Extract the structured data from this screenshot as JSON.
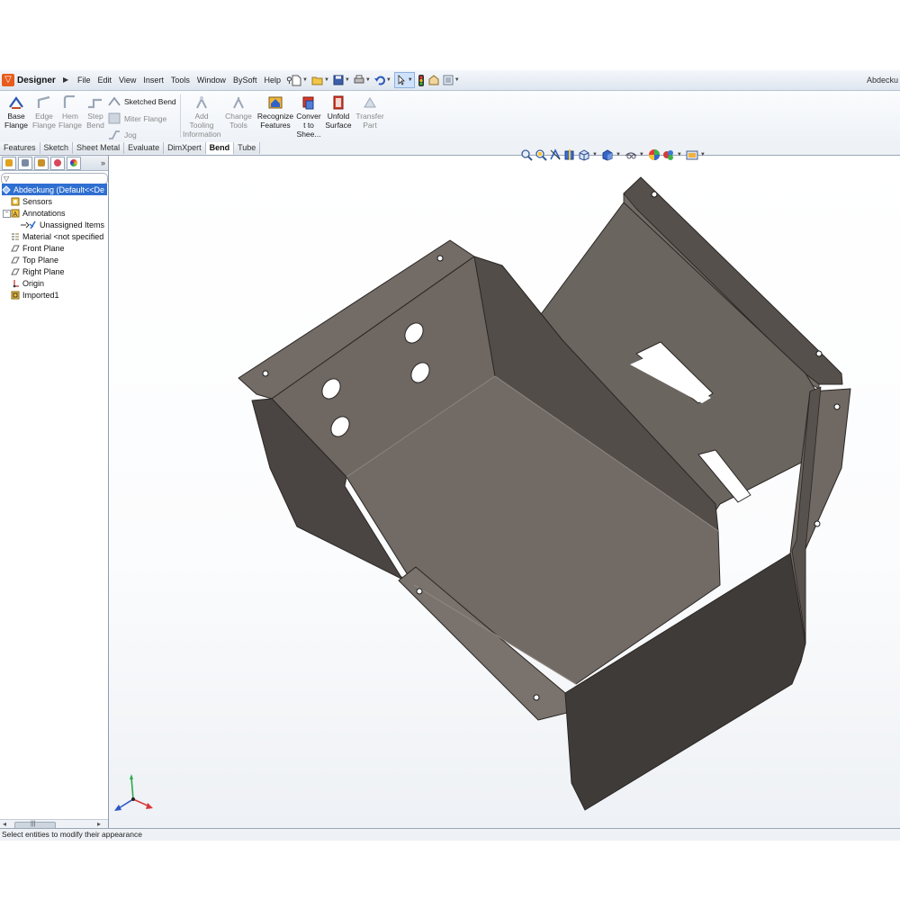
{
  "app": {
    "brand": "Designer",
    "document_title": "Abdecku",
    "accent_orange": "#e85b1c",
    "selection_blue": "#2f6fd1"
  },
  "menu": {
    "items": [
      "File",
      "Edit",
      "View",
      "Insert",
      "Tools",
      "Window",
      "BySoft",
      "Help"
    ]
  },
  "quick_access": {
    "icons": [
      "new-document-icon",
      "open-folder-icon",
      "save-icon",
      "print-icon",
      "undo-icon",
      "select-pointer-icon",
      "rebuild-icon",
      "file-properties-icon",
      "options-icon"
    ]
  },
  "ribbon": {
    "base_flange": "Base\nFlange",
    "edge_flange": "Edge\nFlange",
    "hem_flange": "Hem\nFlange",
    "step_bend": "Step\nBend",
    "sketched_bend": "Sketched Bend",
    "miter_flange": "Miter Flange",
    "jog": "Jog",
    "add_tooling": "Add\nTooling\nInformation",
    "change_tools": "Change\nTools",
    "recognize_features": "Recognize\nFeatures",
    "convert_to_sheet": "Conver\nt to\nShee...",
    "unfold_surface": "Unfold\nSurface",
    "transfer_part": "Transfer\nPart"
  },
  "tabs": [
    {
      "label": "Features",
      "active": false
    },
    {
      "label": "Sketch",
      "active": false
    },
    {
      "label": "Sheet Metal",
      "active": false
    },
    {
      "label": "Evaluate",
      "active": false
    },
    {
      "label": "DimXpert",
      "active": false
    },
    {
      "label": "Bend",
      "active": true
    },
    {
      "label": "Tube",
      "active": false
    }
  ],
  "feature_manager": {
    "more": "»",
    "tree": [
      {
        "label": "Abdeckung  (Default<<De",
        "icon": "part-icon",
        "selected": true
      },
      {
        "label": "Sensors",
        "icon": "sensors-icon"
      },
      {
        "label": "Annotations",
        "icon": "annotations-icon"
      },
      {
        "label": "Unassigned Items",
        "icon": "unassigned-items-icon"
      },
      {
        "label": "Material <not specified",
        "icon": "material-icon"
      },
      {
        "label": "Front Plane",
        "icon": "plane-icon"
      },
      {
        "label": "Top Plane",
        "icon": "plane-icon"
      },
      {
        "label": "Right Plane",
        "icon": "plane-icon"
      },
      {
        "label": "Origin",
        "icon": "origin-icon"
      },
      {
        "label": "Imported1",
        "icon": "imported-body-icon"
      }
    ]
  },
  "view_toolbar": {
    "icons": [
      "zoom-to-fit-icon",
      "zoom-to-area-icon",
      "previous-view-icon",
      "section-view-icon",
      "view-orientation-icon",
      "display-style-icon",
      "hide-show-items-icon",
      "edit-appearance-icon",
      "apply-scene-icon",
      "view-settings-icon"
    ]
  },
  "status": {
    "text": "Select entities to modify their appearance"
  }
}
